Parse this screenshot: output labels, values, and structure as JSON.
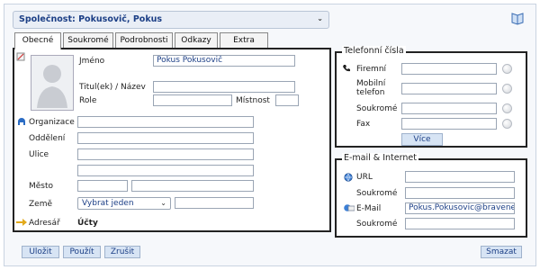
{
  "header": {
    "company_select": "Společnost: Pokusovič, Pokus",
    "book_icon": "book-icon"
  },
  "tabs": [
    {
      "label": "Obecné",
      "active": true
    },
    {
      "label": "Soukromé",
      "active": false
    },
    {
      "label": "Podrobnosti",
      "active": false
    },
    {
      "label": "Odkazy",
      "active": false
    },
    {
      "label": "Extra",
      "active": false
    }
  ],
  "general": {
    "name_label": "Jméno",
    "name_value": "Pokus Pokusovič",
    "title_label": "Titul(ek) / Název",
    "role_label": "Role",
    "room_label": "Místnost",
    "organization_label": "Organizace",
    "department_label": "Oddělení",
    "street_label": "Ulice",
    "city_label": "Město",
    "country_label": "Země",
    "country_value": "Vybrat jeden",
    "addressbook_label": "Adresář",
    "addressbook_value": "Účty"
  },
  "phones": {
    "legend": "Telefonní čísla",
    "business_label": "Firemní",
    "mobile_label_1": "Mobilní",
    "mobile_label_2": "telefon",
    "private_label": "Soukromé",
    "fax_label": "Fax",
    "more_button": "Více"
  },
  "internet": {
    "legend": "E-mail & Internet",
    "url_label": "URL",
    "private_url_label": "Soukromé",
    "email_label": "E-Mail",
    "email_value": "Pokus.Pokusovic@bravene",
    "private_email_label": "Soukromé"
  },
  "footer": {
    "save": "Uložit",
    "apply": "Použít",
    "cancel": "Zrušit",
    "delete": "Smazat"
  },
  "colors": {
    "accent": "#1c3f86",
    "button_bg": "#d7e4f4",
    "panel_border": "#222222"
  }
}
